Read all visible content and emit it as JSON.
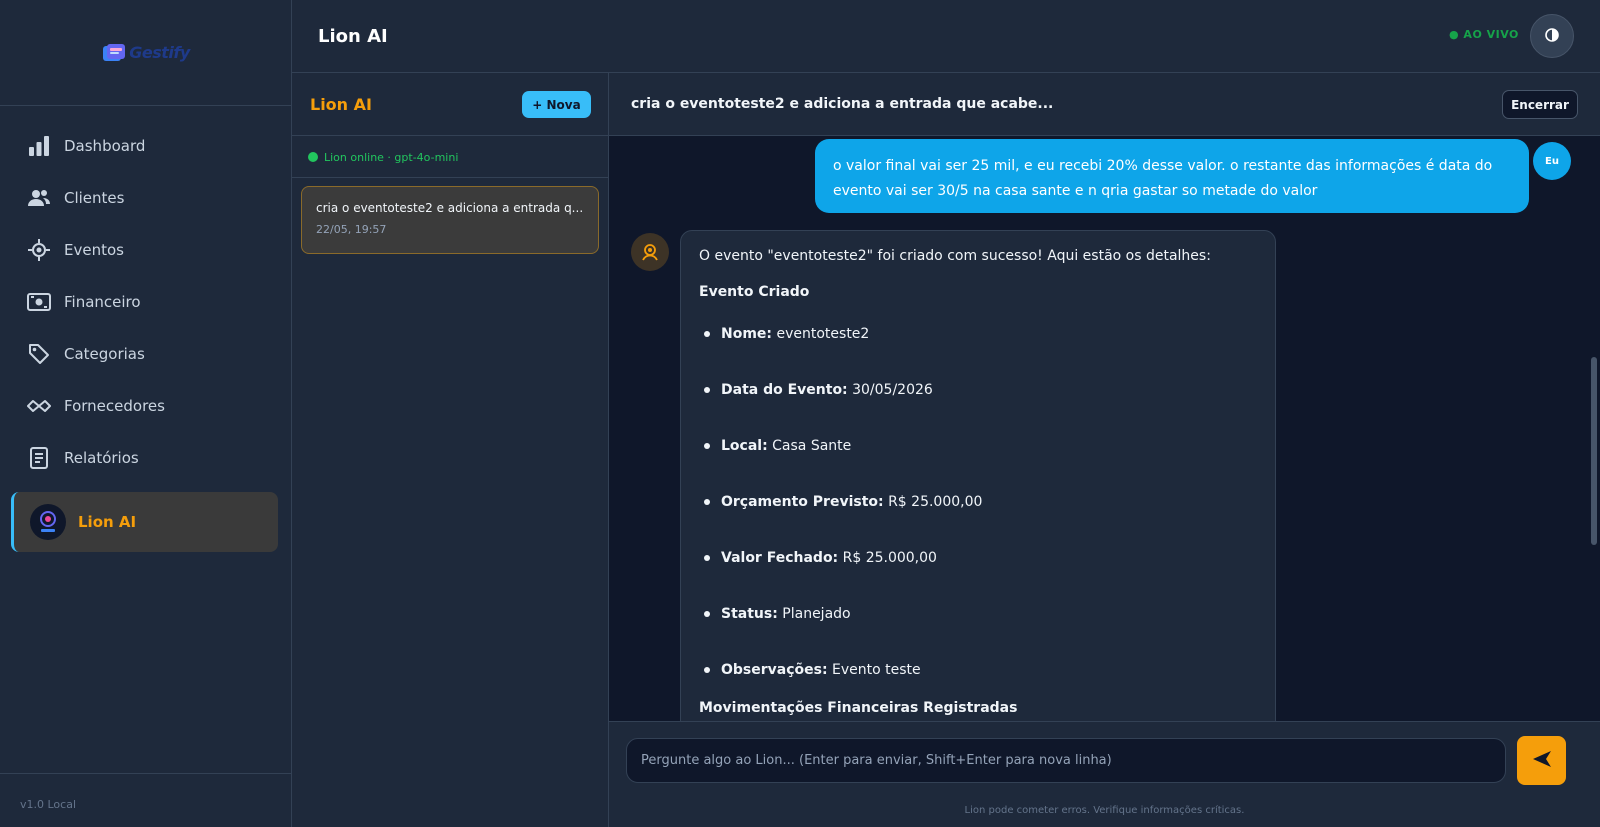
{
  "brand": {
    "name": "Gestify"
  },
  "sidebar": {
    "items": [
      {
        "label": "Dashboard",
        "icon": "bar-chart-icon"
      },
      {
        "label": "Clientes",
        "icon": "users-icon"
      },
      {
        "label": "Eventos",
        "icon": "target-icon"
      },
      {
        "label": "Financeiro",
        "icon": "money-icon"
      },
      {
        "label": "Categorias",
        "icon": "tag-icon"
      },
      {
        "label": "Fornecedores",
        "icon": "handshake-icon"
      },
      {
        "label": "Relatórios",
        "icon": "document-icon"
      }
    ],
    "active_item": {
      "label": "Lion AI",
      "icon": "lion-avatar-icon"
    },
    "version": "v1.0 Local"
  },
  "header": {
    "title": "Lion AI",
    "live_label": "● AO VIVO"
  },
  "conversations": {
    "title": "Lion AI",
    "new_label": "+ Nova",
    "status": "Lion online · gpt-4o-mini",
    "items": [
      {
        "title": "cria o eventoteste2 e adiciona a entrada q...",
        "date": "22/05, 19:57"
      }
    ]
  },
  "chat": {
    "title": "cria o eventoteste2 e adiciona a entrada que acabe...",
    "end_label": "Encerrar",
    "user_message": "o valor final vai ser 25 mil, e eu recebi 20% desse valor. o restante das informações é data do evento vai ser 30/5 na casa sante e n qria gastar so metade do valor",
    "user_avatar": "Eu",
    "bot": {
      "intro": "O evento \"eventoteste2\" foi criado com sucesso! Aqui estão os detalhes:",
      "heading": "Evento Criado",
      "fields": [
        {
          "key": "Nome:",
          "value": "eventoteste2"
        },
        {
          "key": "Data do Evento:",
          "value": "30/05/2026"
        },
        {
          "key": "Local:",
          "value": "Casa Sante"
        },
        {
          "key": "Orçamento Previsto:",
          "value": "R$ 25.000,00"
        },
        {
          "key": "Valor Fechado:",
          "value": "R$ 25.000,00"
        },
        {
          "key": "Status:",
          "value": "Planejado"
        },
        {
          "key": "Observações:",
          "value": "Evento teste"
        }
      ],
      "heading2": "Movimentações Financeiras Registradas"
    },
    "input_placeholder": "Pergunte algo ao Lion... (Enter para enviar, Shift+Enter para nova linha)",
    "disclaimer": "Lion pode cometer erros. Verifique informações críticas."
  },
  "colors": {
    "accent": "#f59e0b",
    "primary": "#0ea5e9",
    "live": "#16a34a"
  }
}
